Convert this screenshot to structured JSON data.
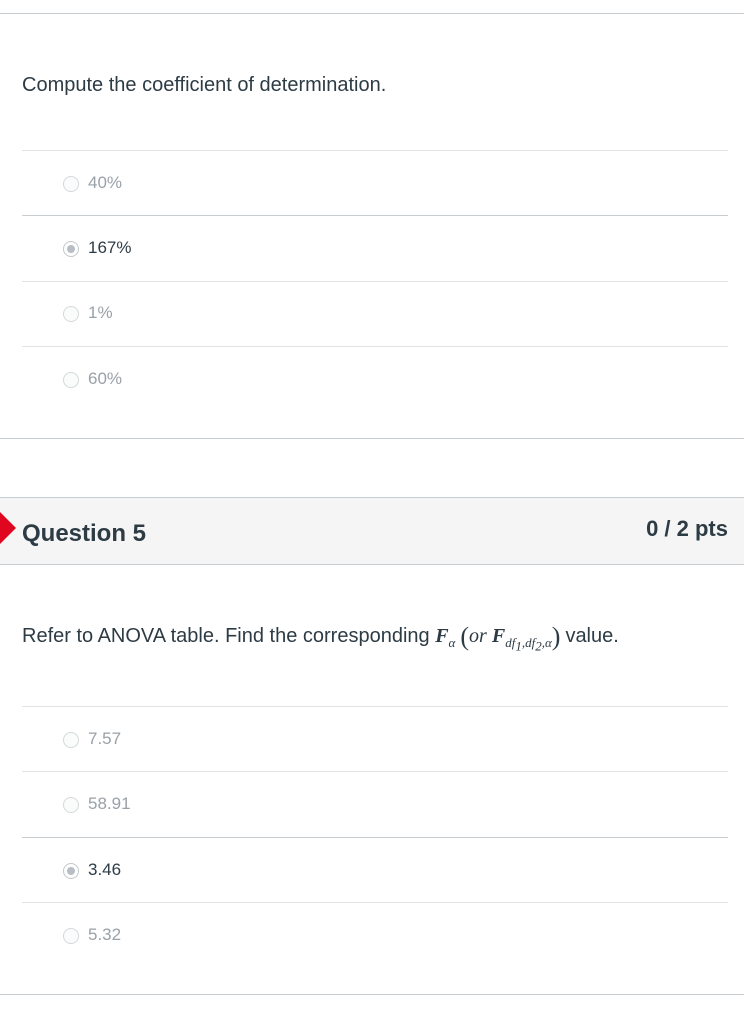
{
  "question4": {
    "prompt": "Compute the coefficient of determination.",
    "answers": [
      {
        "label": "40%",
        "selected": false
      },
      {
        "label": "167%",
        "selected": true
      },
      {
        "label": "1%",
        "selected": false
      },
      {
        "label": "60%",
        "selected": false
      }
    ]
  },
  "question5": {
    "title": "Question 5",
    "points": "0 / 2 pts",
    "status_color": "#e0061f",
    "prompt_prefix": "Refer to ANOVA table. Find the corresponding",
    "formula": {
      "F": "F",
      "alpha": "α",
      "or": "or",
      "df_sub": "df",
      "sub1": "1",
      "sub2": "2",
      "comma": ","
    },
    "prompt_suffix": "value.",
    "answers": [
      {
        "label": "7.57",
        "selected": false
      },
      {
        "label": "58.91",
        "selected": false
      },
      {
        "label": "3.46",
        "selected": true
      },
      {
        "label": "5.32",
        "selected": false
      }
    ]
  }
}
